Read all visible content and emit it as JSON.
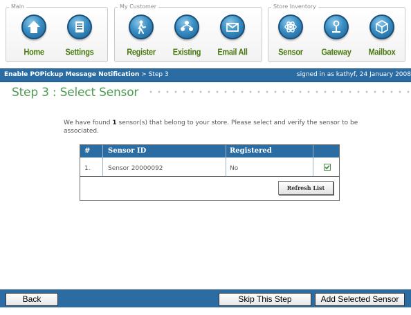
{
  "toolbar": {
    "groups": [
      {
        "label": "Main",
        "items": [
          {
            "label": "Home",
            "icon": "home-icon"
          },
          {
            "label": "Settings",
            "icon": "settings-icon"
          }
        ]
      },
      {
        "label": "My Customer",
        "items": [
          {
            "label": "Register",
            "icon": "register-icon"
          },
          {
            "label": "Existing",
            "icon": "existing-icon"
          },
          {
            "label": "Email All",
            "icon": "email-icon"
          }
        ]
      },
      {
        "label": "Store Inventory",
        "items": [
          {
            "label": "Sensor",
            "icon": "sensor-icon"
          },
          {
            "label": "Gateway",
            "icon": "gateway-icon"
          },
          {
            "label": "Mailbox",
            "icon": "mailbox-icon"
          }
        ]
      }
    ]
  },
  "header": {
    "breadcrumb_title": "Enable POPickup Message Notification",
    "breadcrumb_step": " > Step 3",
    "signed_in": "signed in as kathyf, 24 January 2008"
  },
  "step": {
    "title": "Step 3 : Select Sensor"
  },
  "message": {
    "prefix": "We have found ",
    "count": "1",
    "suffix": " sensor(s) that belong to your store. Please select and verify the sensor to be associated."
  },
  "table": {
    "headers": {
      "num": "#",
      "sensor_id": "Sensor ID",
      "registered": "Registered"
    },
    "rows": [
      {
        "num": "1.",
        "sensor_id": "Sensor 20000092",
        "registered": "No",
        "selected": true
      }
    ],
    "refresh_label": "Refresh List"
  },
  "footer": {
    "back_label": "Back",
    "skip_label": "Skip This Step",
    "add_label": "Add Selected Sensor"
  },
  "colors": {
    "brand_blue": "#2b6ca3",
    "title_green": "#4d9a52",
    "icon_label_green": "#4a7a12"
  }
}
